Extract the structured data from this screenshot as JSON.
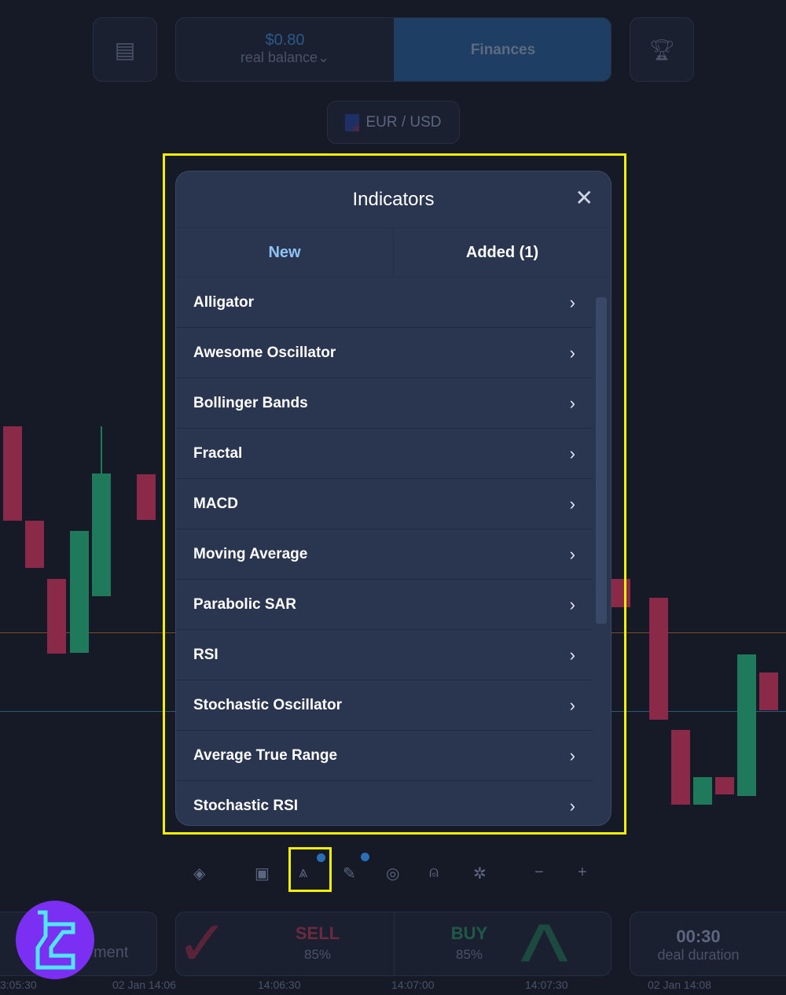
{
  "header": {
    "balance": "$0.80",
    "balance_label": "real balance",
    "finances": "Finances",
    "pair": "EUR / USD"
  },
  "modal": {
    "title": "Indicators",
    "tabs": [
      {
        "label": "New",
        "active": true
      },
      {
        "label": "Added (1)",
        "active": false
      }
    ],
    "items": [
      "Alligator",
      "Awesome Oscillator",
      "Bollinger Bands",
      "Fractal",
      "MACD",
      "Moving Average",
      "Parabolic SAR",
      "RSI",
      "Stochastic Oscillator",
      "Average True Range",
      "Stochastic RSI"
    ]
  },
  "toolbar": {
    "icons": [
      "indicators-alt-icon",
      "chart-type-icon",
      "indicators-icon",
      "pencil-icon",
      "crosshair-icon",
      "add-user-icon",
      "settings-icon",
      "zoom-out-icon",
      "zoom-in-icon"
    ]
  },
  "trade": {
    "investment": "ment",
    "sell": "SELL",
    "sell_pct": "85%",
    "buy": "BUY",
    "buy_pct": "85%",
    "duration": "00:30",
    "duration_label": "deal duration"
  },
  "time_axis": [
    "3:05:30",
    "02 Jan 14:06",
    "14:06:30",
    "14:07:00",
    "14:07:30",
    "02 Jan 14:08"
  ],
  "colors": {
    "accent": "#2a6fb5",
    "sell": "#8a2a48",
    "buy": "#1f7a5c",
    "highlight": "#f5f000"
  }
}
